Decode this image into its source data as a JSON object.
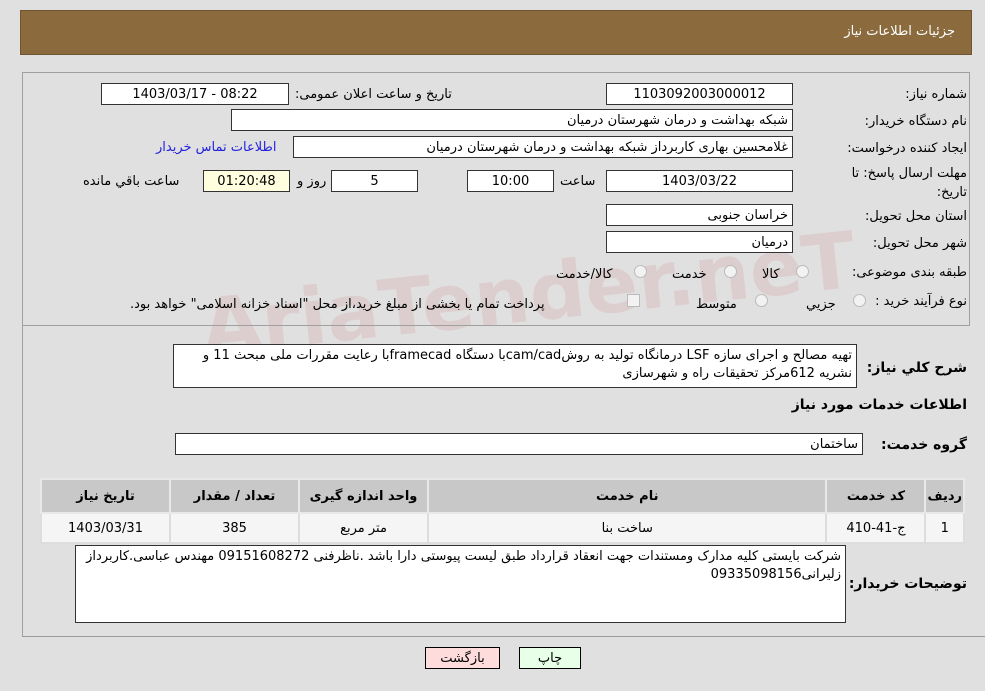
{
  "header": {
    "title": "جزئیات اطلاعات نیاز"
  },
  "fields": {
    "need_number_label": "شماره نیاز:",
    "need_number": "1103092003000012",
    "announce_label": "تاریخ و ساعت اعلان عمومی:",
    "announce_value": "1403/03/17 - 08:22",
    "buyer_org_label": "نام دستگاه خریدار:",
    "buyer_org": "شبکه بهداشت و درمان شهرستان درمیان",
    "creator_label": "ایجاد کننده درخواست:",
    "creator": "غلامحسین بهاری کاربرداز شبکه بهداشت و درمان شهرستان درمیان",
    "contact_link": "اطلاعات تماس خریدار",
    "deadline_label": "مهلت ارسال پاسخ: تا تاریخ:",
    "deadline_date": "1403/03/22",
    "time_label": "ساعت",
    "deadline_time": "10:00",
    "days": "5",
    "days_label": "روز و",
    "remaining": "01:20:48",
    "remaining_label": "ساعت باقي مانده",
    "province_label": "استان محل تحویل:",
    "province": "خراسان جنوبی",
    "city_label": "شهر محل تحویل:",
    "city": "درمیان",
    "category_label": "طبقه بندی موضوعی:",
    "category_options": [
      "کالا",
      "خدمت",
      "کالا/خدمت"
    ],
    "process_label": "نوع فرآیند خرید :",
    "process_options": [
      "جزیي",
      "متوسط"
    ],
    "process_note": "پرداخت تمام یا بخشی از مبلغ خرید،از محل \"اسناد خزانه اسلامی\" خواهد بود.",
    "desc_label": "شرح کلي نیاز:",
    "desc": "تهیه مصالح و اجرای سازه  LSF درمانگاه  تولید به روشcam/cadبا دستگاه framecadبا رعایت مقررات ملی مبحث 11 و نشریه 612مرکز تحقیقات راه و شهرسازی",
    "services_title": "اطلاعات خدمات مورد نیاز",
    "group_label": "گروه خدمت:",
    "group": "ساختمان",
    "buyer_notes_label": "توضیحات خریدار:",
    "buyer_notes": "شرکت بایستی کلیه مدارک ومستندات جهت انعقاد قرارداد طبق لیست پیوستی دارا باشد  .ناظرفنی 09151608272 مهندس عباسی.کاربرداز زلیرانی09335098156"
  },
  "table": {
    "headers": [
      "ردیف",
      "کد خدمت",
      "نام خدمت",
      "واحد اندازه گیری",
      "تعداد / مقدار",
      "تاریخ نیاز"
    ],
    "rows": [
      [
        "1",
        "ج-41-410",
        "ساخت بنا",
        "متر مربع",
        "385",
        "1403/03/31"
      ]
    ]
  },
  "buttons": {
    "print": "چاپ",
    "back": "بازگشت"
  },
  "watermark": "AriaTender.neT"
}
